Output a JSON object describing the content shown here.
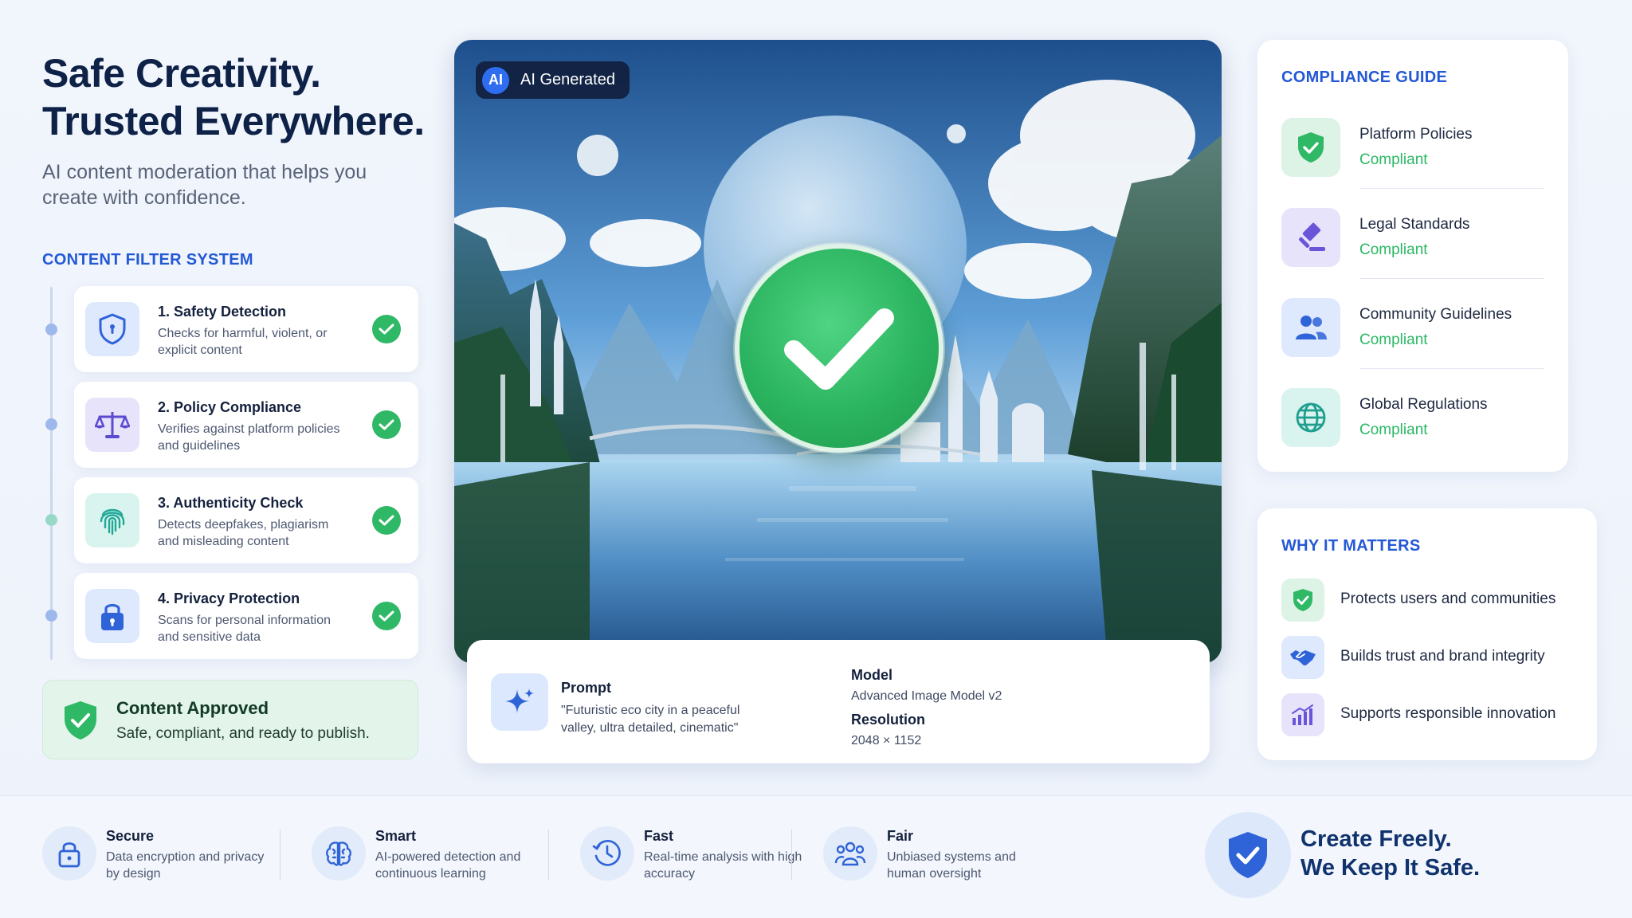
{
  "hero": {
    "title_line1": "Safe Creativity.",
    "title_line2": "Trusted Everywhere.",
    "subtitle": "AI content moderation that helps you create with confidence."
  },
  "filter_system": {
    "label": "CONTENT FILTER SYSTEM",
    "items": [
      {
        "title": "1. Safety Detection",
        "desc": "Checks for harmful, violent, or explicit content",
        "icon": "shield-icon"
      },
      {
        "title": "2. Policy Compliance",
        "desc": "Verifies against platform policies and guidelines",
        "icon": "scales-icon"
      },
      {
        "title": "3. Authenticity Check",
        "desc": "Detects deepfakes, plagiarism and misleading content",
        "icon": "fingerprint-icon"
      },
      {
        "title": "4. Privacy Protection",
        "desc": "Scans for personal information and sensitive data",
        "icon": "lock-icon"
      }
    ]
  },
  "approved": {
    "title": "Content Approved",
    "subtitle": "Safe, compliant, and ready to publish."
  },
  "image": {
    "badge_chip": "AI",
    "badge_label": "AI Generated"
  },
  "meta": {
    "prompt_label": "Prompt",
    "prompt_text": "\"Futuristic eco city in a peaceful valley, ultra detailed, cinematic\"",
    "model_label": "Model",
    "model_value": "Advanced Image Model v2",
    "resolution_label": "Resolution",
    "resolution_value": "2048 × 1152"
  },
  "compliance": {
    "label": "COMPLIANCE GUIDE",
    "items": [
      {
        "title": "Platform Policies",
        "status": "Compliant",
        "icon": "shield-check-icon"
      },
      {
        "title": "Legal Standards",
        "status": "Compliant",
        "icon": "gavel-icon"
      },
      {
        "title": "Community Guidelines",
        "status": "Compliant",
        "icon": "people-icon"
      },
      {
        "title": "Global Regulations",
        "status": "Compliant",
        "icon": "globe-icon"
      }
    ]
  },
  "why": {
    "label": "WHY IT MATTERS",
    "items": [
      {
        "text": "Protects users and communities",
        "icon": "shield-check-icon"
      },
      {
        "text": "Builds trust and brand integrity",
        "icon": "handshake-icon"
      },
      {
        "text": "Supports responsible innovation",
        "icon": "growth-chart-icon"
      }
    ]
  },
  "features": [
    {
      "title": "Secure",
      "desc": "Data encryption and privacy by design",
      "icon": "lock-icon"
    },
    {
      "title": "Smart",
      "desc": "AI-powered detection and continuous learning",
      "icon": "brain-icon"
    },
    {
      "title": "Fast",
      "desc": "Real-time analysis with high accuracy",
      "icon": "clock-icon"
    },
    {
      "title": "Fair",
      "desc": "Unbiased systems and human oversight",
      "icon": "team-icon"
    }
  ],
  "cta": {
    "line1": "Create Freely.",
    "line2": "We Keep It Safe."
  },
  "colors": {
    "accent": "#2358d6",
    "success": "#2fb865",
    "title": "#0e2147"
  }
}
